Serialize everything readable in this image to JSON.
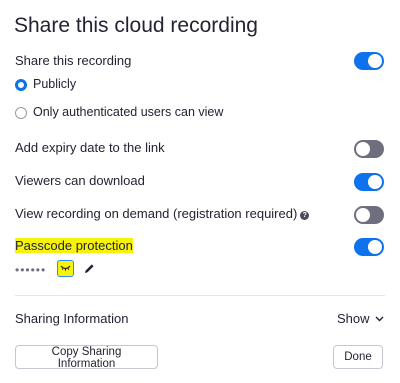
{
  "title": "Share this cloud recording",
  "share": {
    "label": "Share this recording",
    "enabled": true,
    "options": [
      {
        "label": "Publicly",
        "selected": true
      },
      {
        "label": "Only authenticated users can view",
        "selected": false
      }
    ]
  },
  "expiry": {
    "label": "Add expiry date to the link",
    "enabled": false
  },
  "download": {
    "label": "Viewers can download",
    "enabled": true
  },
  "on_demand": {
    "label": "View recording on demand (registration required)",
    "enabled": false,
    "help_icon": "question-circle-icon"
  },
  "passcode": {
    "label": "Passcode protection",
    "enabled": true,
    "masked_value": "••••••",
    "reveal_icon": "eye-icon",
    "edit_icon": "pencil-icon",
    "highlight_color": "#f7f20b"
  },
  "sharing_info": {
    "label": "Sharing Information",
    "toggle_label": "Show"
  },
  "buttons": {
    "copy": "Copy Sharing Information",
    "done": "Done"
  },
  "colors": {
    "accent": "#0e72ed",
    "toggle_off": "#6e6e7e",
    "text": "#232333"
  }
}
